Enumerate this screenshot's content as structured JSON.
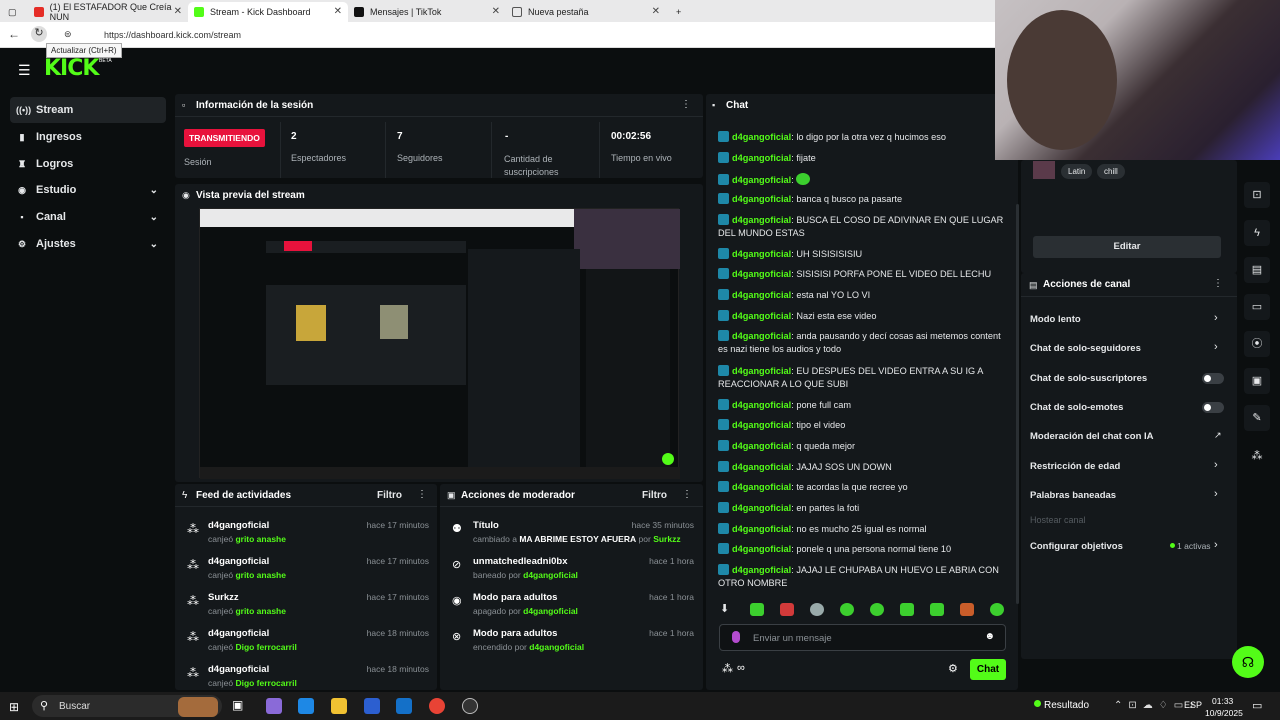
{
  "browser": {
    "tabs": [
      {
        "title": "(1) El ESTAFADOR Que Creía NUN"
      },
      {
        "title": "Stream - Kick Dashboard"
      },
      {
        "title": "Mensajes | TikTok"
      },
      {
        "title": "Nueva pestaña"
      }
    ],
    "url": "https://dashboard.kick.com/stream",
    "reload_tooltip": "Actualizar (Ctrl+R)"
  },
  "app": {
    "logo": "KICK",
    "beta": "BETA"
  },
  "sidebar": {
    "items": [
      {
        "label": "Stream"
      },
      {
        "label": "Ingresos"
      },
      {
        "label": "Logros"
      },
      {
        "label": "Estudio"
      },
      {
        "label": "Canal"
      },
      {
        "label": "Ajustes"
      }
    ]
  },
  "session": {
    "title": "Información de la sesión",
    "status": "TRANSMITIENDO",
    "status_label": "Sesión",
    "stats": [
      {
        "value": "2",
        "label": "Espectadores"
      },
      {
        "value": "7",
        "label": "Seguidores"
      },
      {
        "value": "-",
        "label": "Cantidad de suscripciones"
      },
      {
        "value": "00:02:56",
        "label": "Tiempo en vivo"
      }
    ]
  },
  "preview": {
    "title": "Vista previa del stream"
  },
  "activity": {
    "title": "Feed de actividades",
    "filter": "Filtro",
    "items": [
      {
        "user": "d4gangoficial",
        "verb": "canjeó",
        "item": "grito anashe",
        "time": "hace 17 minutos"
      },
      {
        "user": "d4gangoficial",
        "verb": "canjeó",
        "item": "grito anashe",
        "time": "hace 17 minutos"
      },
      {
        "user": "Surkzz",
        "verb": "canjeó",
        "item": "grito anashe",
        "time": "hace 17 minutos"
      },
      {
        "user": "d4gangoficial",
        "verb": "canjeó",
        "item": "Digo ferrocarril",
        "time": "hace 18 minutos"
      },
      {
        "user": "d4gangoficial",
        "verb": "canjeó",
        "item": "Digo ferrocarril",
        "time": "hace 18 minutos"
      }
    ]
  },
  "modactions": {
    "title": "Acciones de moderador",
    "filter": "Filtro",
    "items": [
      {
        "title": "Título",
        "pre": "cambiado a",
        "detail": "MA ABRIME ESTOY AFUERA",
        "by": "por",
        "user": "Surkzz",
        "time": "hace 35 minutos"
      },
      {
        "title": "unmatchedleadni0bx",
        "pre": "baneado por",
        "detail": "",
        "by": "",
        "user": "d4gangoficial",
        "time": "hace 1 hora"
      },
      {
        "title": "Modo para adultos",
        "pre": "apagado por",
        "detail": "",
        "by": "",
        "user": "d4gangoficial",
        "time": "hace 1 hora"
      },
      {
        "title": "Modo para adultos",
        "pre": "encendido por",
        "detail": "",
        "by": "",
        "user": "d4gangoficial",
        "time": "hace 1 hora"
      }
    ]
  },
  "chat": {
    "title": "Chat",
    "messages": [
      {
        "user": "d4gangoficial",
        "text": "lo digo por la otra vez q hucimos eso"
      },
      {
        "user": "d4gangoficial",
        "text": "fijate"
      },
      {
        "user": "d4gangoficial",
        "text": ""
      },
      {
        "user": "d4gangoficial",
        "text": "banca q busco pa pasarte"
      },
      {
        "user": "d4gangoficial",
        "text": "BUSCA EL COSO DE ADIVINAR EN QUE LUGAR DEL MUNDO ESTAS"
      },
      {
        "user": "d4gangoficial",
        "text": "UH SISISISISIU"
      },
      {
        "user": "d4gangoficial",
        "text": "SISISISI PORFA PONE EL VIDEO DEL LECHU"
      },
      {
        "user": "d4gangoficial",
        "text": "esta nal YO LO VI"
      },
      {
        "user": "d4gangoficial",
        "text": "Nazi esta ese video"
      },
      {
        "user": "d4gangoficial",
        "text": "anda pausando y decí cosas asi metemos content es nazi tiene los audios y todo"
      },
      {
        "user": "d4gangoficial",
        "text": "EU DESPUES DEL VIDEO ENTRA A SU IG A REACCIONAR A LO QUE SUBI"
      },
      {
        "user": "d4gangoficial",
        "text": "pone full cam"
      },
      {
        "user": "d4gangoficial",
        "text": "tipo el video"
      },
      {
        "user": "d4gangoficial",
        "text": "q queda mejor"
      },
      {
        "user": "d4gangoficial",
        "text": "JAJAJ SOS UN DOWN"
      },
      {
        "user": "d4gangoficial",
        "text": "te acordas la que recree yo"
      },
      {
        "user": "d4gangoficial",
        "text": "en partes la foti"
      },
      {
        "user": "d4gangoficial",
        "text": "no es mucho 25 igual es normal"
      },
      {
        "user": "d4gangoficial",
        "text": "ponele q una persona normal tiene 10"
      },
      {
        "user": "d4gangoficial",
        "text": "JAJAJ LE CHUPABA UN HUEVO LE ABRIA CON OTRO NOMBRE"
      }
    ],
    "input_placeholder": "Enviar un mensaje",
    "send": "Chat"
  },
  "channel": {
    "tags": [
      "Latin",
      "chill"
    ],
    "edit": "Editar",
    "actions_title": "Acciones de canal",
    "actions": [
      {
        "label": "Modo lento"
      },
      {
        "label": "Chat de solo-seguidores"
      },
      {
        "label": "Chat de solo-suscriptores"
      },
      {
        "label": "Chat de solo-emotes"
      },
      {
        "label": "Moderación del chat con IA"
      },
      {
        "label": "Restricción de edad"
      },
      {
        "label": "Palabras baneadas"
      },
      {
        "label": "Hostear canal"
      },
      {
        "label": "Configurar objetivos"
      }
    ],
    "goals_active": "1 activas"
  },
  "taskbar": {
    "search": "Buscar",
    "result": "Resultado",
    "lang": "ESP",
    "time": "01:33",
    "date": "10/9/2025"
  },
  "colors": {
    "accent": "#53fc18",
    "live": "#e8123c",
    "bg": "#0b0e0f",
    "panel": "#14181b"
  }
}
